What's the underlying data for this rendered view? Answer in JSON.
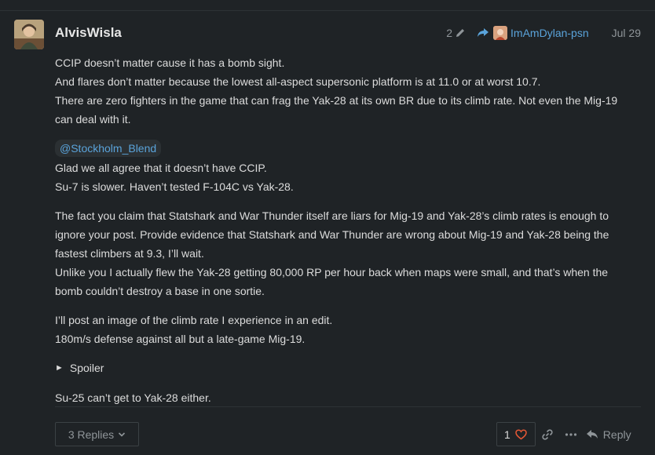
{
  "post": {
    "username": "AlvisWisla",
    "edit_count": "2",
    "reply_to_user": "ImAmDylan-psn",
    "date": "Jul 29",
    "paragraphs": [
      [
        "CCIP doesn’t matter cause it has a bomb sight.",
        "And flares don’t matter because the lowest all-aspect supersonic platform is at 11.0 or at worst 10.7.",
        "There are zero fighters in the game that can frag the Yak-28 at its own BR due to its climb rate. Not even the Mig-19 can deal with it."
      ],
      [
        "Glad we all agree that it doesn’t have CCIP.",
        "Su-7 is slower. Haven’t tested F-104C vs Yak-28."
      ],
      [
        "The fact you claim that Statshark and War Thunder itself are liars for Mig-19 and Yak-28’s climb rates is enough to ignore your post. Provide evidence that Statshark and War Thunder are wrong about Mig-19 and Yak-28 being the fastest climbers at 9.3, I’ll wait.",
        "Unlike you I actually flew the Yak-28 getting 80,000 RP per hour back when maps were small, and that’s when the bomb couldn’t destroy a base in one sortie."
      ],
      [
        "I’ll post an image of the climb rate I experience in an edit.",
        "180m/s defense against all but a late-game Mig-19."
      ]
    ],
    "mention": "@Stockholm_Blend",
    "spoiler_label": "Spoiler",
    "final_line": "Su-25 can’t get to Yak-28 either."
  },
  "footer": {
    "replies_label": "3 Replies",
    "like_count": "1",
    "reply_label": "Reply"
  },
  "colors": {
    "background": "#1f2326",
    "link": "#5aa3da",
    "like_heart": "#e45735",
    "muted": "#8f9599"
  },
  "icons": [
    "pencil-icon",
    "share-arrow-icon",
    "chevron-down-icon",
    "heart-icon",
    "link-icon",
    "ellipsis-icon",
    "reply-arrow-icon",
    "spoiler-triangle-icon"
  ]
}
